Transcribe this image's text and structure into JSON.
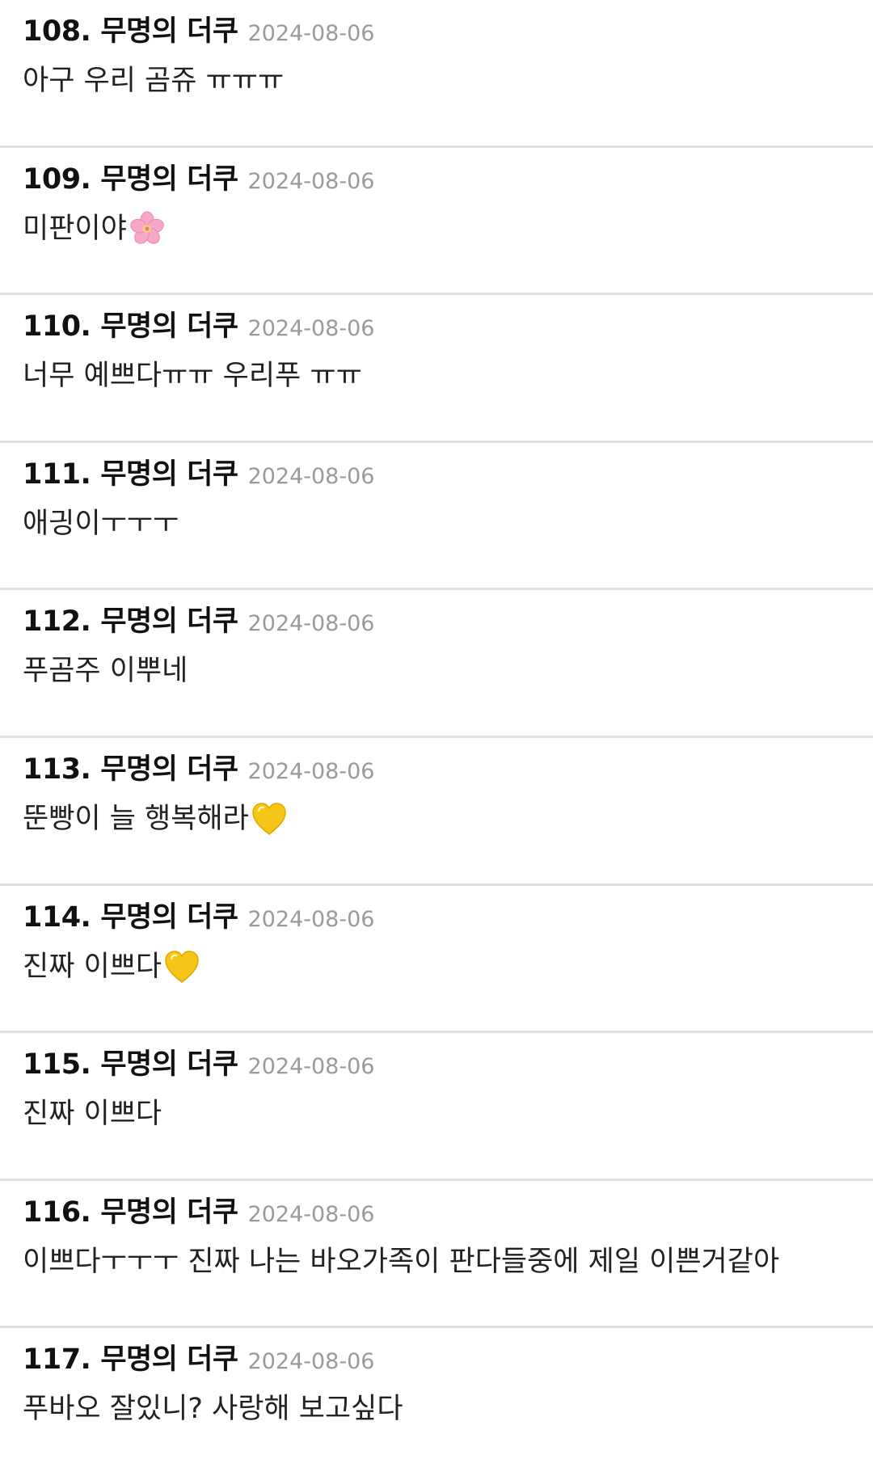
{
  "comments": [
    {
      "number": "108.",
      "author": "무명의 더쿠",
      "date": "2024-08-06",
      "text": "아구 우리 곰쥬 ㅠㅠㅠ",
      "emoji": ""
    },
    {
      "number": "109.",
      "author": "무명의 더쿠",
      "date": "2024-08-06",
      "text": "미판이야",
      "emoji": "cherry-blossom-icon"
    },
    {
      "number": "110.",
      "author": "무명의 더쿠",
      "date": "2024-08-06",
      "text": "너무 예쁘다ㅠㅠ 우리푸 ㅠㅠ",
      "emoji": ""
    },
    {
      "number": "111.",
      "author": "무명의 더쿠",
      "date": "2024-08-06",
      "text": "애긩이ㅜㅜㅜ",
      "emoji": ""
    },
    {
      "number": "112.",
      "author": "무명의 더쿠",
      "date": "2024-08-06",
      "text": "푸곰주 이뿌네",
      "emoji": ""
    },
    {
      "number": "113.",
      "author": "무명의 더쿠",
      "date": "2024-08-06",
      "text": "뚠빵이 늘 행복해라",
      "emoji": "yellow-heart-icon"
    },
    {
      "number": "114.",
      "author": "무명의 더쿠",
      "date": "2024-08-06",
      "text": "진짜 이쁘다",
      "emoji": "yellow-heart-icon"
    },
    {
      "number": "115.",
      "author": "무명의 더쿠",
      "date": "2024-08-06",
      "text": "진짜 이쁘다",
      "emoji": ""
    },
    {
      "number": "116.",
      "author": "무명의 더쿠",
      "date": "2024-08-06",
      "text": "이쁘다ㅜㅜㅜ 진짜 나는 바오가족이 판다들중에 제일 이쁜거같아",
      "emoji": ""
    },
    {
      "number": "117.",
      "author": "무명의 더쿠",
      "date": "2024-08-06",
      "text": "푸바오 잘있니? 사랑해 보고싶다",
      "emoji": ""
    }
  ],
  "colors": {
    "text": "#111111",
    "date": "#9a9a9a",
    "divider": "#e1e1e1",
    "yellow_heart": "#f5c518",
    "cherry_blossom": "#f7a8c8"
  }
}
